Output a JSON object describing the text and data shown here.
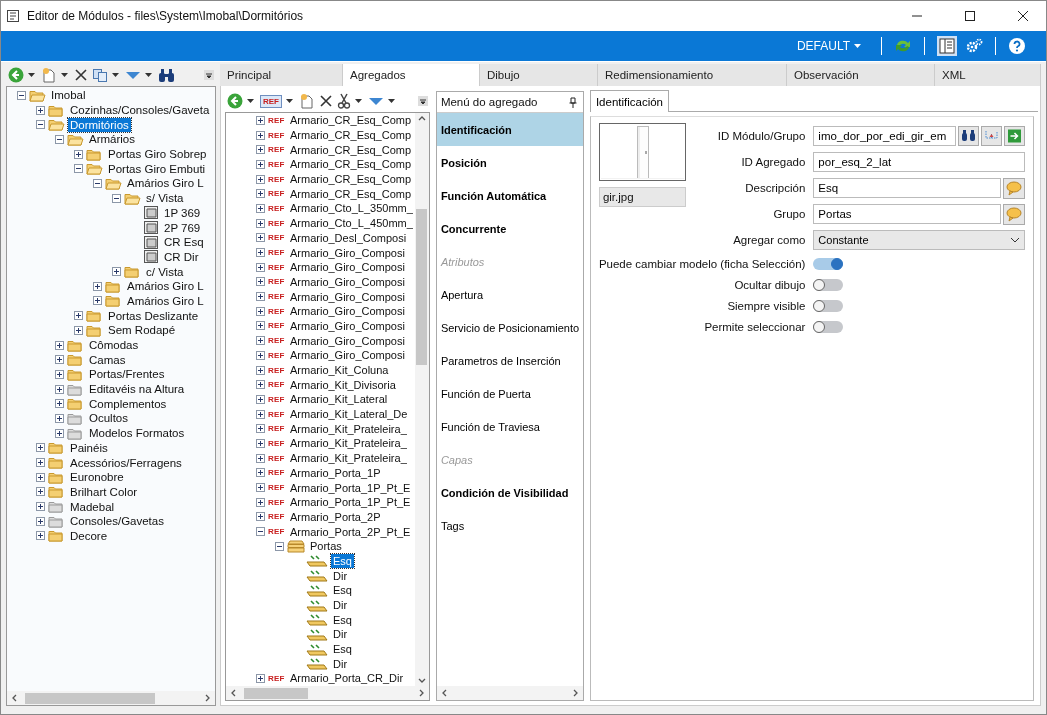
{
  "window": {
    "title": "Editor de Módulos - files\\System\\Imobal\\Dormitórios"
  },
  "ribbon": {
    "profile": "DEFAULT"
  },
  "explorer": {
    "tree": [
      {
        "label": "Imobal",
        "kind": "folder",
        "expanded": true,
        "selected": false,
        "children": [
          {
            "label": "Cozinhas/Consoles/Gaveta",
            "kind": "folder",
            "expanded": false,
            "selected": false
          },
          {
            "label": "Dormitórios",
            "kind": "folder",
            "expanded": true,
            "selected": true,
            "children": [
              {
                "label": "Armários",
                "kind": "folder",
                "expanded": true,
                "selected": false,
                "children": [
                  {
                    "label": "Portas Giro Sobrep",
                    "kind": "folder",
                    "expanded": false,
                    "selected": false
                  },
                  {
                    "label": "Portas Giro Embuti",
                    "kind": "folder",
                    "expanded": true,
                    "selected": false,
                    "children": [
                      {
                        "label": "Amários Giro L",
                        "kind": "folder",
                        "expanded": true,
                        "selected": false,
                        "children": [
                          {
                            "label": "s/ Vista",
                            "kind": "folder",
                            "expanded": true,
                            "selected": false,
                            "children": [
                              {
                                "label": "1P 369",
                                "kind": "cabinet",
                                "selected": false
                              },
                              {
                                "label": "2P 769",
                                "kind": "cabinet",
                                "selected": false
                              },
                              {
                                "label": "CR Esq",
                                "kind": "cabinet",
                                "selected": false
                              },
                              {
                                "label": "CR Dir",
                                "kind": "cabinet",
                                "selected": false
                              }
                            ]
                          },
                          {
                            "label": "c/ Vista",
                            "kind": "folder",
                            "expanded": false,
                            "selected": false
                          }
                        ]
                      },
                      {
                        "label": "Amários Giro L",
                        "kind": "folder",
                        "expanded": false,
                        "selected": false
                      },
                      {
                        "label": "Amários Giro L",
                        "kind": "folder",
                        "expanded": false,
                        "selected": false
                      }
                    ]
                  },
                  {
                    "label": "Portas Deslizante",
                    "kind": "folder",
                    "expanded": false,
                    "selected": false
                  },
                  {
                    "label": "Sem Rodapé",
                    "kind": "folder",
                    "expanded": false,
                    "selected": false
                  }
                ]
              },
              {
                "label": "Cômodas",
                "kind": "folder",
                "expanded": false,
                "selected": false
              },
              {
                "label": "Camas",
                "kind": "folder",
                "expanded": false,
                "selected": false
              },
              {
                "label": "Portas/Frentes",
                "kind": "folder",
                "expanded": false,
                "selected": false
              },
              {
                "label": "Editavéis na Altura",
                "kind": "folder-gray",
                "expanded": false,
                "selected": false
              },
              {
                "label": "Complementos",
                "kind": "folder",
                "expanded": false,
                "selected": false
              },
              {
                "label": "Ocultos",
                "kind": "folder-gray",
                "expanded": false,
                "selected": false
              },
              {
                "label": "Modelos Formatos",
                "kind": "folder-gray",
                "expanded": false,
                "selected": false
              }
            ]
          },
          {
            "label": "Painéis",
            "kind": "folder",
            "expanded": false,
            "selected": false
          },
          {
            "label": "Acessórios/Ferragens",
            "kind": "folder",
            "expanded": false,
            "selected": false
          },
          {
            "label": "Euronobre",
            "kind": "folder",
            "expanded": false,
            "selected": false
          },
          {
            "label": "Brilhart Color",
            "kind": "folder",
            "expanded": false,
            "selected": false
          },
          {
            "label": "Madebal",
            "kind": "folder-gray",
            "expanded": false,
            "selected": false
          },
          {
            "label": "Consoles/Gavetas",
            "kind": "folder-gray",
            "expanded": false,
            "selected": false
          },
          {
            "label": "Decore",
            "kind": "folder",
            "expanded": false,
            "selected": false
          }
        ]
      }
    ]
  },
  "tabs": [
    {
      "label": "Principal",
      "selected": false
    },
    {
      "label": "Agregados",
      "selected": true
    },
    {
      "label": "Dibujo",
      "selected": false
    },
    {
      "label": "Redimensionamiento",
      "selected": false
    },
    {
      "label": "Observación",
      "selected": false
    },
    {
      "label": "XML",
      "selected": false
    }
  ],
  "aggregates": {
    "toolbar_tag": "REF",
    "items": [
      {
        "kind": "ref",
        "tag": "REF",
        "label": "Armario_CR_Esq_Comp",
        "expanded": false,
        "selected": false
      },
      {
        "kind": "ref",
        "tag": "REF",
        "label": "Armario_CR_Esq_Comp",
        "expanded": false,
        "selected": false
      },
      {
        "kind": "ref",
        "tag": "REF",
        "label": "Armario_CR_Esq_Comp",
        "expanded": false,
        "selected": false
      },
      {
        "kind": "ref",
        "tag": "REF",
        "label": "Armario_CR_Esq_Comp",
        "expanded": false,
        "selected": false
      },
      {
        "kind": "ref",
        "tag": "REF",
        "label": "Armario_CR_Esq_Comp",
        "expanded": false,
        "selected": false
      },
      {
        "kind": "ref",
        "tag": "REF",
        "label": "Armario_CR_Esq_Comp",
        "expanded": false,
        "selected": false
      },
      {
        "kind": "ref",
        "tag": "REF",
        "label": "Armario_Cto_L_350mm_",
        "expanded": false,
        "selected": false
      },
      {
        "kind": "ref",
        "tag": "REF",
        "label": "Armario_Cto_L_450mm_",
        "expanded": false,
        "selected": false
      },
      {
        "kind": "ref",
        "tag": "REF",
        "label": "Armario_Desl_Composi",
        "expanded": false,
        "selected": false
      },
      {
        "kind": "ref",
        "tag": "REF",
        "label": "Armario_Giro_Composi",
        "expanded": false,
        "selected": false
      },
      {
        "kind": "ref",
        "tag": "REF",
        "label": "Armario_Giro_Composi",
        "expanded": false,
        "selected": false
      },
      {
        "kind": "ref",
        "tag": "REF",
        "label": "Armario_Giro_Composi",
        "expanded": false,
        "selected": false
      },
      {
        "kind": "ref",
        "tag": "REF",
        "label": "Armario_Giro_Composi",
        "expanded": false,
        "selected": false
      },
      {
        "kind": "ref",
        "tag": "REF",
        "label": "Armario_Giro_Composi",
        "expanded": false,
        "selected": false
      },
      {
        "kind": "ref",
        "tag": "REF",
        "label": "Armario_Giro_Composi",
        "expanded": false,
        "selected": false
      },
      {
        "kind": "ref",
        "tag": "REF",
        "label": "Armario_Giro_Composi",
        "expanded": false,
        "selected": false
      },
      {
        "kind": "ref",
        "tag": "REF",
        "label": "Armario_Giro_Composi",
        "expanded": false,
        "selected": false
      },
      {
        "kind": "ref",
        "tag": "REF",
        "label": "Armario_Kit_Coluna",
        "expanded": false,
        "selected": false
      },
      {
        "kind": "ref",
        "tag": "REF",
        "label": "Armario_Kit_Divisoria",
        "expanded": false,
        "selected": false
      },
      {
        "kind": "ref",
        "tag": "REF",
        "label": "Armario_Kit_Lateral",
        "expanded": false,
        "selected": false
      },
      {
        "kind": "ref",
        "tag": "REF",
        "label": "Armario_Kit_Lateral_De",
        "expanded": false,
        "selected": false
      },
      {
        "kind": "ref",
        "tag": "REF",
        "label": "Armario_Kit_Prateleira_",
        "expanded": false,
        "selected": false
      },
      {
        "kind": "ref",
        "tag": "REF",
        "label": "Armario_Kit_Prateleira_",
        "expanded": false,
        "selected": false
      },
      {
        "kind": "ref",
        "tag": "REF",
        "label": "Armario_Kit_Prateleira_",
        "expanded": false,
        "selected": false
      },
      {
        "kind": "ref",
        "tag": "REF",
        "label": "Armario_Porta_1P",
        "expanded": false,
        "selected": false
      },
      {
        "kind": "ref",
        "tag": "REF",
        "label": "Armario_Porta_1P_Pt_E",
        "expanded": false,
        "selected": false
      },
      {
        "kind": "ref",
        "tag": "REF",
        "label": "Armario_Porta_1P_Pt_E",
        "expanded": false,
        "selected": false
      },
      {
        "kind": "ref",
        "tag": "REF",
        "label": "Armario_Porta_2P",
        "expanded": false,
        "selected": false
      },
      {
        "kind": "ref",
        "tag": "REF",
        "label": "Armario_Porta_2P_Pt_E",
        "expanded": true,
        "selected": false,
        "children": [
          {
            "kind": "group",
            "label": "Portas",
            "expanded": true,
            "selected": false,
            "children": [
              {
                "kind": "door",
                "label": "Esq",
                "selected": true
              },
              {
                "kind": "door",
                "label": "Dir",
                "selected": false
              },
              {
                "kind": "door",
                "label": "Esq",
                "selected": false
              },
              {
                "kind": "door",
                "label": "Dir",
                "selected": false
              },
              {
                "kind": "door",
                "label": "Esq",
                "selected": false
              },
              {
                "kind": "door",
                "label": "Dir",
                "selected": false
              },
              {
                "kind": "door",
                "label": "Esq",
                "selected": false
              },
              {
                "kind": "door",
                "label": "Dir",
                "selected": false
              }
            ]
          }
        ]
      },
      {
        "kind": "ref",
        "tag": "REF",
        "label": "Armario_Porta_CR_Dir",
        "expanded": false,
        "selected": false
      }
    ]
  },
  "menu": {
    "title": "Menú do agregado",
    "items": [
      {
        "label": "Identificación",
        "kind": "bold",
        "selected": true
      },
      {
        "label": "Posición",
        "kind": "bold",
        "selected": false
      },
      {
        "label": "Función Automática",
        "kind": "bold",
        "selected": false
      },
      {
        "label": "Concurrente",
        "kind": "bold",
        "selected": false
      },
      {
        "label": "Atributos",
        "kind": "muted",
        "selected": false
      },
      {
        "label": "Apertura",
        "kind": "plain",
        "selected": false
      },
      {
        "label": "Servicio de Posicionamiento",
        "kind": "plain",
        "selected": false
      },
      {
        "label": "Parametros de Inserción",
        "kind": "plain",
        "selected": false
      },
      {
        "label": "Función de Puerta",
        "kind": "plain",
        "selected": false
      },
      {
        "label": "Función de Traviesa",
        "kind": "plain",
        "selected": false
      },
      {
        "label": "Capas",
        "kind": "muted",
        "selected": false
      },
      {
        "label": "Condición de Visibilidad",
        "kind": "bold",
        "selected": false
      },
      {
        "label": "Tags",
        "kind": "plain",
        "selected": false
      }
    ]
  },
  "form": {
    "tabs": [
      {
        "label": "Identificación",
        "selected": true
      }
    ],
    "image_caption": "gir.jpg",
    "fields": [
      {
        "kind": "lookup",
        "label": "ID Módulo/Grupo",
        "value": "imo_dor_por_edi_gir_em"
      },
      {
        "kind": "text",
        "label": "ID Agregado",
        "value": "por_esq_2_lat"
      },
      {
        "kind": "translatable",
        "label": "Descripción",
        "value": "Esq"
      },
      {
        "kind": "translatable",
        "label": "Grupo",
        "value": "Portas"
      },
      {
        "kind": "select",
        "label": "Agregar como",
        "value": "Constante"
      }
    ],
    "toggles": [
      {
        "label": "Puede cambiar modelo (ficha Selección)",
        "on": true
      },
      {
        "label": "Ocultar dibujo",
        "on": false
      },
      {
        "label": "Siempre visible",
        "on": false
      },
      {
        "label": "Permite seleccionar",
        "on": false
      }
    ]
  }
}
